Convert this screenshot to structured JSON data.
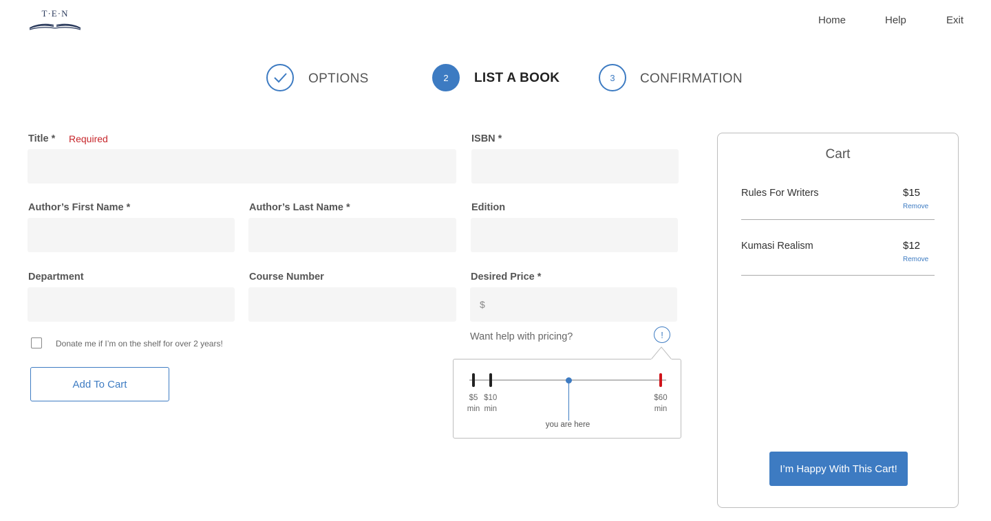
{
  "brand": {
    "logo_text": "T·E·N",
    "primary_color": "#3d7bc2",
    "error_color": "#c7262b"
  },
  "nav": {
    "home": "Home",
    "help": "Help",
    "exit": "Exit"
  },
  "steps": [
    {
      "number": "",
      "label": "OPTIONS",
      "state": "complete"
    },
    {
      "number": "2",
      "label": "LIST A BOOK",
      "state": "active"
    },
    {
      "number": "3",
      "label": "CONFIRMATION",
      "state": "upcoming"
    }
  ],
  "form": {
    "title_label": "Title *",
    "title_error": "Required",
    "isbn_label": "ISBN *",
    "author_first_label": "Author’s First Name *",
    "author_last_label": "Author’s Last Name *",
    "edition_label": "Edition",
    "department_label": "Department",
    "course_number_label": "Course Number",
    "price_label": "Desired Price *",
    "price_prefix": "$",
    "donate_label": "Donate me if I’m on the shelf for over 2 years!",
    "add_to_cart": "Add To Cart"
  },
  "pricing_help": {
    "question": "Want help with pricing?",
    "info_icon": "!",
    "scale_min": 5,
    "scale_max": 60,
    "current_price_position": 0.51,
    "markers": [
      {
        "value": "$5",
        "sub": "min",
        "amount": 5
      },
      {
        "value": "$10",
        "sub": "min",
        "amount": 10
      },
      {
        "value": "$60",
        "sub": "min",
        "amount": 60
      }
    ],
    "pointer_label": "you are here"
  },
  "cart": {
    "title": "Cart",
    "items": [
      {
        "name": "Rules For Writers",
        "price": "$15",
        "remove": "Remove"
      },
      {
        "name": "Kumasi Realism",
        "price": "$12",
        "remove": "Remove"
      }
    ],
    "checkout": "I’m Happy With This Cart!"
  }
}
